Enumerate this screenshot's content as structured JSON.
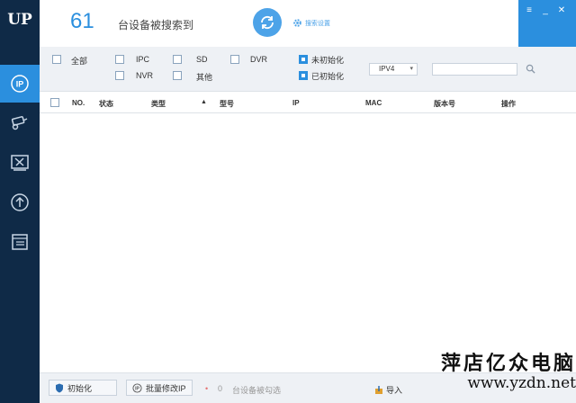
{
  "app": {
    "logo_text": "UP"
  },
  "sidebar": {
    "items": [
      {
        "icon": "ip-icon",
        "active": true
      },
      {
        "icon": "camera-icon",
        "active": false
      },
      {
        "icon": "tools-icon",
        "active": false
      },
      {
        "icon": "upgrade-icon",
        "active": false
      },
      {
        "icon": "document-icon",
        "active": false
      }
    ]
  },
  "header": {
    "device_count": "61",
    "device_count_label": "台设备被搜索到",
    "search_settings_label": "搜索设置"
  },
  "filters": {
    "all": "全部",
    "ipc": "IPC",
    "sd": "SD",
    "dvr": "DVR",
    "nvr": "NVR",
    "other": "其他",
    "uninitialized": "未初始化",
    "initialized": "已初始化",
    "ip_version": "IPV4",
    "search_placeholder": ""
  },
  "table": {
    "columns": [
      "NO.",
      "状态",
      "类型",
      "型号",
      "IP",
      "MAC",
      "版本号",
      "操作"
    ],
    "sort_indicator": "▲",
    "rows": []
  },
  "footer": {
    "initialize_label": "初始化",
    "batch_modify_ip_label": "批量修改IP",
    "selected_count": "0",
    "selected_label": "台设备被勾选",
    "import_label": "导入"
  },
  "watermark": {
    "title": "萍店亿众电脑",
    "url": "www.yzdn.net"
  },
  "colors": {
    "sidebar_bg": "#0f2a47",
    "accent": "#2b8fde",
    "filter_bg": "#eef1f5"
  }
}
